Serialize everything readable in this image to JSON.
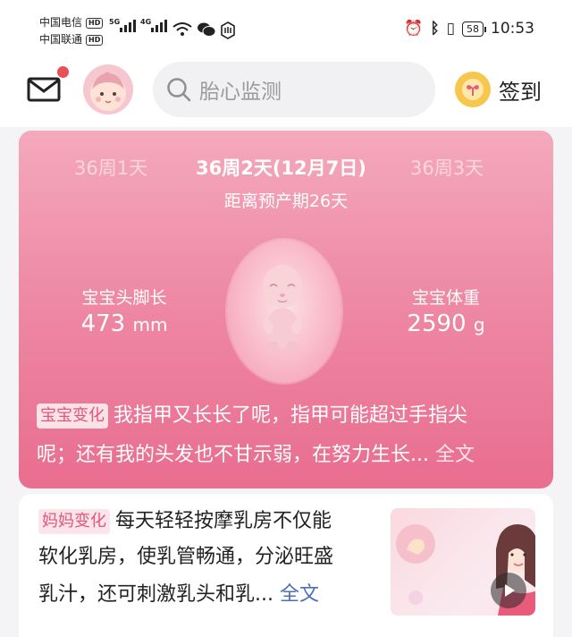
{
  "status_bar": {
    "carrier1": "中国电信",
    "carrier2": "中国联通",
    "hd": "HD",
    "net1": "5G",
    "net2": "4G",
    "battery": "58",
    "time": "10:53"
  },
  "header": {
    "search_placeholder": "胎心监测",
    "checkin_label": "签到",
    "has_unread_mail": true
  },
  "pregnancy_card": {
    "weeks": [
      "36周1天",
      "36周2天(12月7日)",
      "36周3天"
    ],
    "selected_week_index": 1,
    "due_text": "距离预产期26天",
    "head_to_foot": {
      "label": "宝宝头脚长",
      "value": "473",
      "unit": "mm"
    },
    "weight": {
      "label": "宝宝体重",
      "value": "2590",
      "unit": "g"
    },
    "baby_change": {
      "tag": "宝宝变化",
      "line1": "我指甲又长长了呢，指甲可能超过手指尖",
      "line2": "呢；还有我的头发也不甘示弱，在努力生长...",
      "more": "全文"
    }
  },
  "mom_card": {
    "tag": "妈妈变化",
    "line1": "每天轻轻按摩乳房不仅能",
    "line2": "软化乳房，使乳管畅通，分泌旺盛",
    "line3": "乳汁，还可刺激乳头和乳...",
    "more": "全文"
  },
  "colors": {
    "card_pink": "#ee8aa5",
    "tag_text": "#e0567c",
    "link_blue": "#4f6fb3",
    "notification_dot": "#e94f59"
  }
}
